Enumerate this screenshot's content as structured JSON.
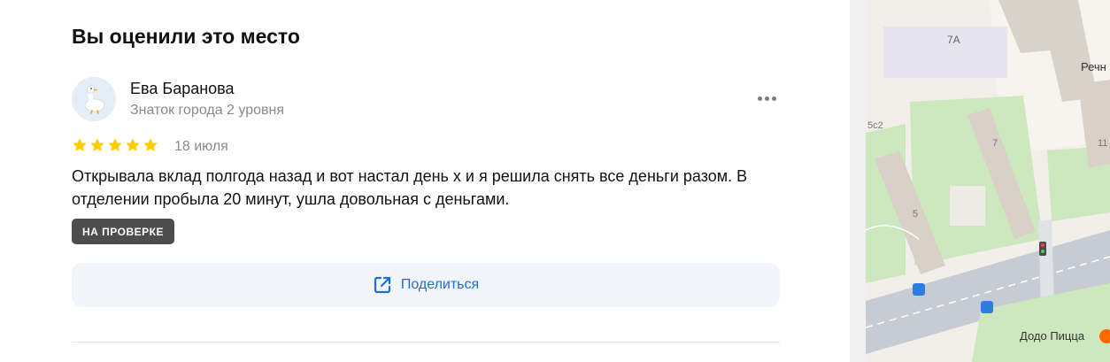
{
  "header": {
    "title": "Вы оценили это место"
  },
  "review": {
    "author": "Ева Баранова",
    "author_level": "Знаток города 2 уровня",
    "rating": 5,
    "rating_max": 5,
    "date": "18 июля",
    "text": "Открывала вклад полгода назад и вот настал день х и я решила снять все деньги разом. В отделении пробыла 20 минут, ушла довольная с деньгами.",
    "status_badge": "НА ПРОВЕРКЕ",
    "avatar_icon": "goose-avatar-icon",
    "star_color": "#ffcc00"
  },
  "actions": {
    "share_label": "Поделиться",
    "share_icon": "external-share-icon",
    "more_icon": "more-dots-icon"
  },
  "map": {
    "labels": {
      "building_7a": "7А",
      "street_partial": "Речн",
      "building_5c2": "5с2",
      "building_7": "7",
      "building_11": "11",
      "building_5": "5",
      "poi_dodo": "Додо Пицца"
    }
  },
  "colors": {
    "accent": "#1a6fd6",
    "badge_bg": "#4d4d4d",
    "map_green": "#cde8bf"
  }
}
